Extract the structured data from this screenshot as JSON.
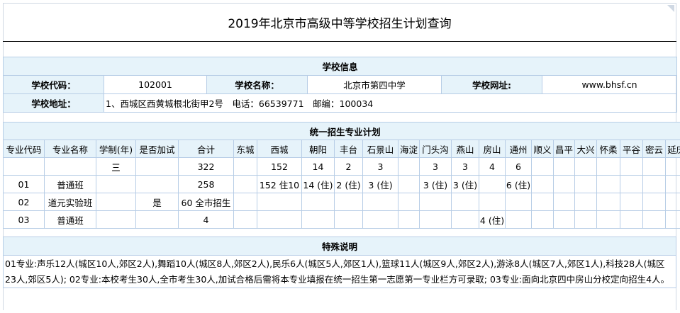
{
  "title": "2019年北京市高级中等学校招生计划查询",
  "school_info": {
    "section_title": "学校信息",
    "code_label": "学校代码：",
    "code": "102001",
    "name_label": "学校名称：",
    "name": "北京市第四中学",
    "site_label": "学校网址:",
    "site": "www.bhsf.cn",
    "address_label": "学校地址：",
    "address": "1、西城区西黄城根北街甲2号　电话：66539771　邮编：100034"
  },
  "plan": {
    "section_title": "统一招生专业计划",
    "headers": [
      "专业代码",
      "专业名称",
      "学制(年)",
      "是否加试",
      "合计",
      "东城",
      "西城",
      "朝阳",
      "丰台",
      "石景山",
      "海淀",
      "门头沟",
      "燕山",
      "房山",
      "通州",
      "顺义",
      "昌平",
      "大兴",
      "怀柔",
      "平谷",
      "密云",
      "延庆"
    ],
    "rows": [
      [
        "",
        "",
        "三",
        "",
        "322",
        "",
        "152",
        "14",
        "2",
        "3",
        "",
        "3",
        "3",
        "4",
        "6",
        "",
        "",
        "",
        "",
        "",
        "",
        ""
      ],
      [
        "01",
        "普通班",
        "",
        "",
        "258",
        "",
        "152 住10",
        "14 (住)",
        "2 (住)",
        "3 (住)",
        "",
        "3 (住)",
        "3 (住)",
        "",
        "6 (住)",
        "",
        "",
        "",
        "",
        "",
        "",
        ""
      ],
      [
        "02",
        "道元实验班",
        "",
        "是",
        "60 全市招生",
        "",
        "",
        "",
        "",
        "",
        "",
        "",
        "",
        "",
        "",
        "",
        "",
        "",
        "",
        "",
        "",
        ""
      ],
      [
        "03",
        "普通班",
        "",
        "",
        "4",
        "",
        "",
        "",
        "",
        "",
        "",
        "",
        "",
        "4 (住)",
        "",
        "",
        "",
        "",
        "",
        "",
        "",
        ""
      ]
    ]
  },
  "notes": {
    "section_title": "特殊说明",
    "text": "01专业:声乐12人(城区10人,郊区2人),舞蹈10人(城区8人,郊区2人),民乐6人(城区5人,郊区1人),篮球11人(城区9人,郊区2人),游泳8人(城区7人,郊区1人),科技28人(城区23人,郊区5人); 02专业:本校考生30人,全市考生30人,加试合格后需将本专业填报在统一招生第一志愿第一专业栏方可录取; 03专业:面向北京四中房山分校定向招生4人。"
  }
}
